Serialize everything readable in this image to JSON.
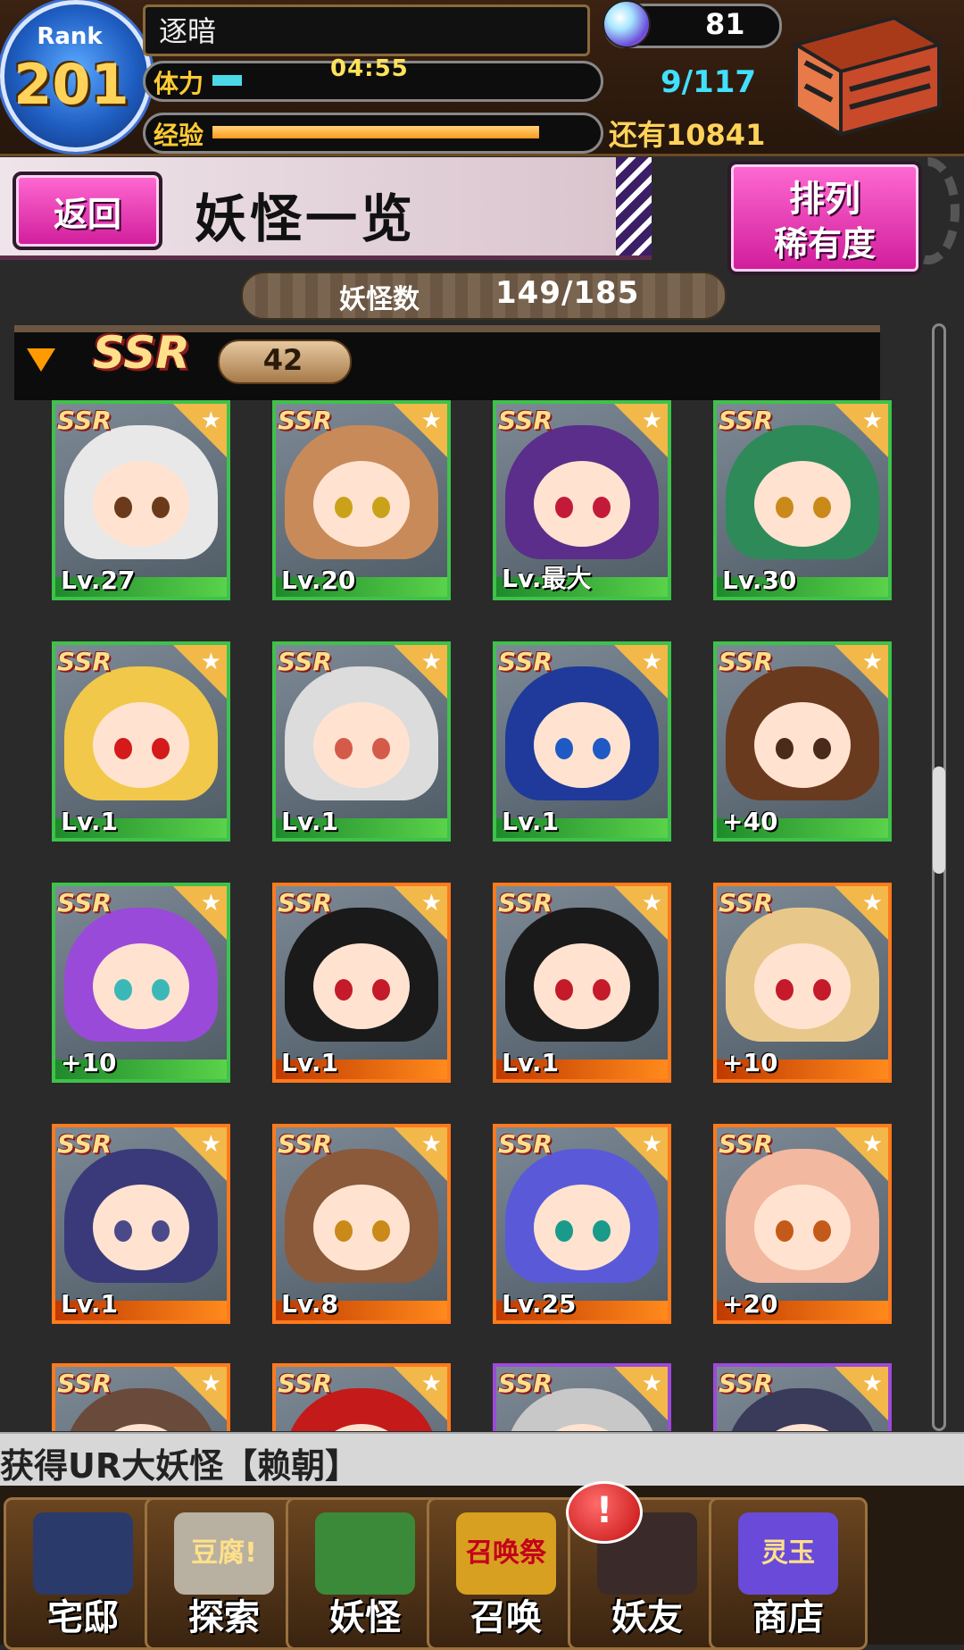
{
  "header": {
    "rank_label": "Rank",
    "rank_value": "201",
    "player_name": "逐暗",
    "stamina_label": "体力",
    "stamina_timer": "04:55",
    "stamina_count": "9/117",
    "stamina_fraction": 0.077,
    "exp_label": "经验",
    "exp_remaining": "还有10841",
    "exp_fraction": 0.86,
    "gem_count": "81",
    "icons": [
      "gem-orb-icon",
      "treasure-chest-icon"
    ]
  },
  "titlebar": {
    "back_label": "返回",
    "title": "妖怪一览",
    "sort_label": "排列",
    "sort_value": "稀有度"
  },
  "counter": {
    "label": "妖怪数",
    "value": "149/185"
  },
  "section": {
    "rarity": "SSR",
    "count": "42"
  },
  "cards": [
    {
      "rarity": "SSR",
      "level": "Lv.27",
      "frame": "green",
      "hair": "#e8e8e8",
      "eyes": "#6b3a1a"
    },
    {
      "rarity": "SSR",
      "level": "Lv.20",
      "frame": "green",
      "hair": "#c98a5a",
      "eyes": "#c9a21a"
    },
    {
      "rarity": "SSR",
      "level": "Lv.最大",
      "frame": "green",
      "hair": "#5a2e8a",
      "eyes": "#c41a3a"
    },
    {
      "rarity": "SSR",
      "level": "Lv.30",
      "frame": "green",
      "hair": "#2f8a5a",
      "eyes": "#c98a1a"
    },
    {
      "rarity": "SSR",
      "level": "Lv.1",
      "frame": "green",
      "hair": "#f2c84a",
      "eyes": "#d41a1a"
    },
    {
      "rarity": "SSR",
      "level": "Lv.1",
      "frame": "green",
      "hair": "#dcdcdc",
      "eyes": "#d45a4a"
    },
    {
      "rarity": "SSR",
      "level": "Lv.1",
      "frame": "green",
      "hair": "#1f3a9a",
      "eyes": "#1f5ac4"
    },
    {
      "rarity": "SSR",
      "level": "+40",
      "frame": "green",
      "hair": "#6a3a1f",
      "eyes": "#4a2a1a"
    },
    {
      "rarity": "SSR",
      "level": "+10",
      "frame": "green",
      "hair": "#9a4ad8",
      "eyes": "#3ab8b8"
    },
    {
      "rarity": "SSR",
      "level": "Lv.1",
      "frame": "orange",
      "hair": "#1a1a1a",
      "eyes": "#c41a2a"
    },
    {
      "rarity": "SSR",
      "level": "Lv.1",
      "frame": "orange",
      "hair": "#1a1a1a",
      "eyes": "#c41a2a"
    },
    {
      "rarity": "SSR",
      "level": "+10",
      "frame": "orange",
      "hair": "#e8c88a",
      "eyes": "#c41a2a"
    },
    {
      "rarity": "SSR",
      "level": "Lv.1",
      "frame": "orange",
      "hair": "#3a3a7a",
      "eyes": "#4a4a8a"
    },
    {
      "rarity": "SSR",
      "level": "Lv.8",
      "frame": "orange",
      "hair": "#8a5a3a",
      "eyes": "#c98a1a"
    },
    {
      "rarity": "SSR",
      "level": "Lv.25",
      "frame": "orange",
      "hair": "#5a5ad8",
      "eyes": "#1a9a8a"
    },
    {
      "rarity": "SSR",
      "level": "+20",
      "frame": "orange",
      "hair": "#f2b8a0",
      "eyes": "#c45a1a"
    },
    {
      "rarity": "SSR",
      "level": "",
      "frame": "orange",
      "hair": "#6a4a3a",
      "eyes": "#000"
    },
    {
      "rarity": "SSR",
      "level": "",
      "frame": "orange",
      "hair": "#c41a1a",
      "eyes": "#000"
    },
    {
      "rarity": "SSR",
      "level": "",
      "frame": "purple",
      "hair": "#c8c8c8",
      "eyes": "#000"
    },
    {
      "rarity": "SSR",
      "level": "",
      "frame": "purple",
      "hair": "#3a3a5a",
      "eyes": "#000"
    }
  ],
  "ticker": {
    "text": "获得UR大妖怪【赖朝】"
  },
  "nav": [
    {
      "label": "宅邸",
      "icon": "mansion-icon",
      "badge": ""
    },
    {
      "label": "探索",
      "icon": "explore-tofu-icon",
      "badge": "豆腐!"
    },
    {
      "label": "妖怪",
      "icon": "yokai-scroll-icon",
      "badge": ""
    },
    {
      "label": "召唤",
      "icon": "summon-festival-icon",
      "badge": "召唤祭"
    },
    {
      "label": "妖友",
      "icon": "yokai-friend-icon",
      "badge": ""
    },
    {
      "label": "商店",
      "icon": "shop-orb-icon",
      "badge": "灵玉"
    }
  ],
  "alert": "!",
  "colors": {
    "accent_pink": "#d01c9a",
    "frame_green": "#3fc24a",
    "frame_orange": "#ff7a1c",
    "frame_purple": "#9c4ad8",
    "stamina_fill": "#4bd9e8",
    "exp_fill": "#ff9a1c"
  }
}
